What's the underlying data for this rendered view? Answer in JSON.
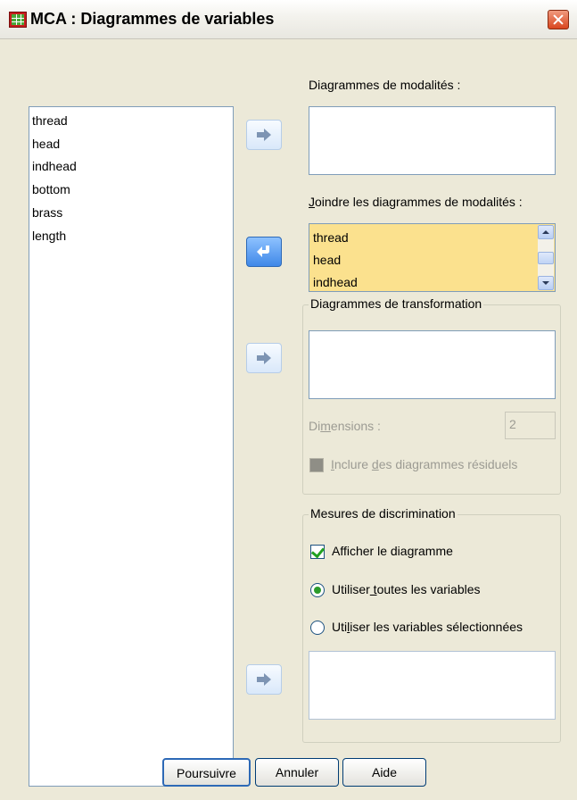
{
  "window": {
    "title": "MCA : Diagrammes de variables",
    "close_icon": "close-icon",
    "app_icon": "spss-grid-icon"
  },
  "source_list": {
    "items": [
      "thread",
      "head",
      "indhead",
      "bottom",
      "brass",
      "length"
    ]
  },
  "category_plots": {
    "label": "Diagrammes de modalités :"
  },
  "joint_category_plots": {
    "label_prefix": "",
    "label_mnemonic": "J",
    "label_rest": "oindre les diagrammes de modalités :",
    "items": [
      "thread",
      "head",
      "indhead"
    ]
  },
  "transformation_plots": {
    "legend": "Diagrammes de transformation",
    "dimensions_label_pre": "Di",
    "dimensions_label_mn": "m",
    "dimensions_label_post": "ensions :",
    "dimensions_value": "2",
    "residual_pre": "",
    "residual_mn": "I",
    "residual_mid": "nclure ",
    "residual_mn2": "d",
    "residual_post": "es diagrammes résiduels"
  },
  "discrimination": {
    "legend": "Mesures de discrimination",
    "display_plot_label": "Afficher le diagramme",
    "display_plot_checked": true,
    "use_all_pre": "Utiliser",
    "use_all_mn": " t",
    "use_all_post": "outes les variables",
    "use_selected_pre": "Uti",
    "use_selected_mn": "l",
    "use_selected_post": "iser les variables sélectionnées",
    "selected_option": "use_all"
  },
  "buttons": {
    "continue": "Poursuivre",
    "cancel": "Annuler",
    "help": "Aide"
  }
}
